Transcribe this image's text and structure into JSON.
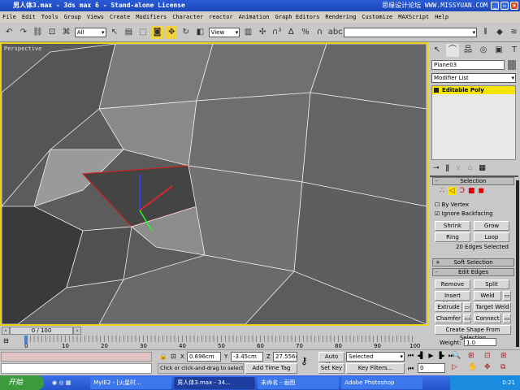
{
  "window": {
    "title": "男人体3.max - 3ds max 6 - Stand-alone License",
    "watermark": "思缘设计论坛 WWW.MISSYUAN.COM"
  },
  "menu": [
    "File",
    "Edit",
    "Tools",
    "Group",
    "Views",
    "Create",
    "Modifiers",
    "Character",
    "reactor",
    "Animation",
    "Graph Editors",
    "Rendering",
    "Customize",
    "MAXScript",
    "Help"
  ],
  "toolbar": {
    "filter": "All",
    "coord": "View",
    "named_sel": ""
  },
  "viewport": {
    "label": "Perspective"
  },
  "panel": {
    "object_name": "Plane03",
    "modifier_list": "Modifier List",
    "stack_item": "Editable Poly",
    "selection": {
      "title": "Selection",
      "by_vertex": "By Vertex",
      "ignore_backfacing": "Ignore Backfacing",
      "shrink": "Shrink",
      "grow": "Grow",
      "ring": "Ring",
      "loop": "Loop",
      "status": "20 Edges Selected"
    },
    "soft_selection": "Soft Selection",
    "edit_edges": {
      "title": "Edit Edges",
      "remove": "Remove",
      "split": "Split",
      "insert_vertex": "Insert Vertex",
      "weld": "Weld",
      "extrude": "Extrude",
      "target_weld": "Target Weld",
      "chamfer": "Chamfer",
      "connect": "Connect",
      "create_shape": "Create Shape From Selection",
      "weight_label": "Weight:",
      "weight": "1.0"
    }
  },
  "timeline": {
    "frame": "0 / 100",
    "ticks": [
      "0",
      "10",
      "20",
      "30",
      "40",
      "50",
      "60",
      "70",
      "80",
      "90",
      "100"
    ],
    "progress": 0
  },
  "status": {
    "x": "0.696cm",
    "y": "-3.45cm",
    "z": "27.556cm",
    "prompt": "Click or click-and-drag to select obj",
    "add_time_tag": "Add Time Tag",
    "auto_key": "Auto Key",
    "key_mode": "Selected",
    "set_key": "Set Key",
    "key_filters": "Key Filters...",
    "current_frame": "0"
  },
  "taskbar": {
    "start": "开始",
    "tasks": [
      "MyIE2 - [火星时...",
      "男人体3.max - 34...",
      "未命名 - 画图",
      "Adobe Photoshop"
    ],
    "clock": "0:21"
  }
}
